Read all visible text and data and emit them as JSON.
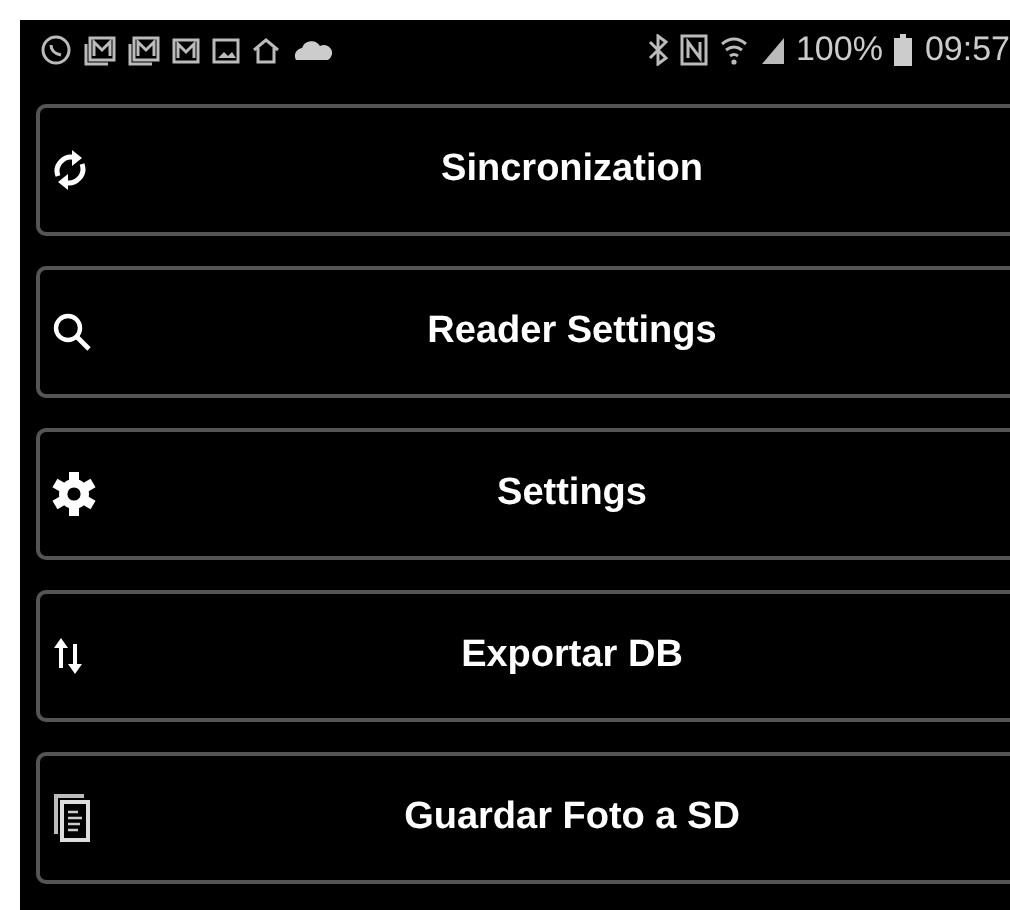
{
  "status_bar": {
    "battery": "100%",
    "time": "09:57"
  },
  "menu": [
    {
      "label": "Sincronization"
    },
    {
      "label": "Reader Settings"
    },
    {
      "label": "Settings"
    },
    {
      "label": "Exportar DB"
    },
    {
      "label": "Guardar Foto a SD"
    }
  ]
}
